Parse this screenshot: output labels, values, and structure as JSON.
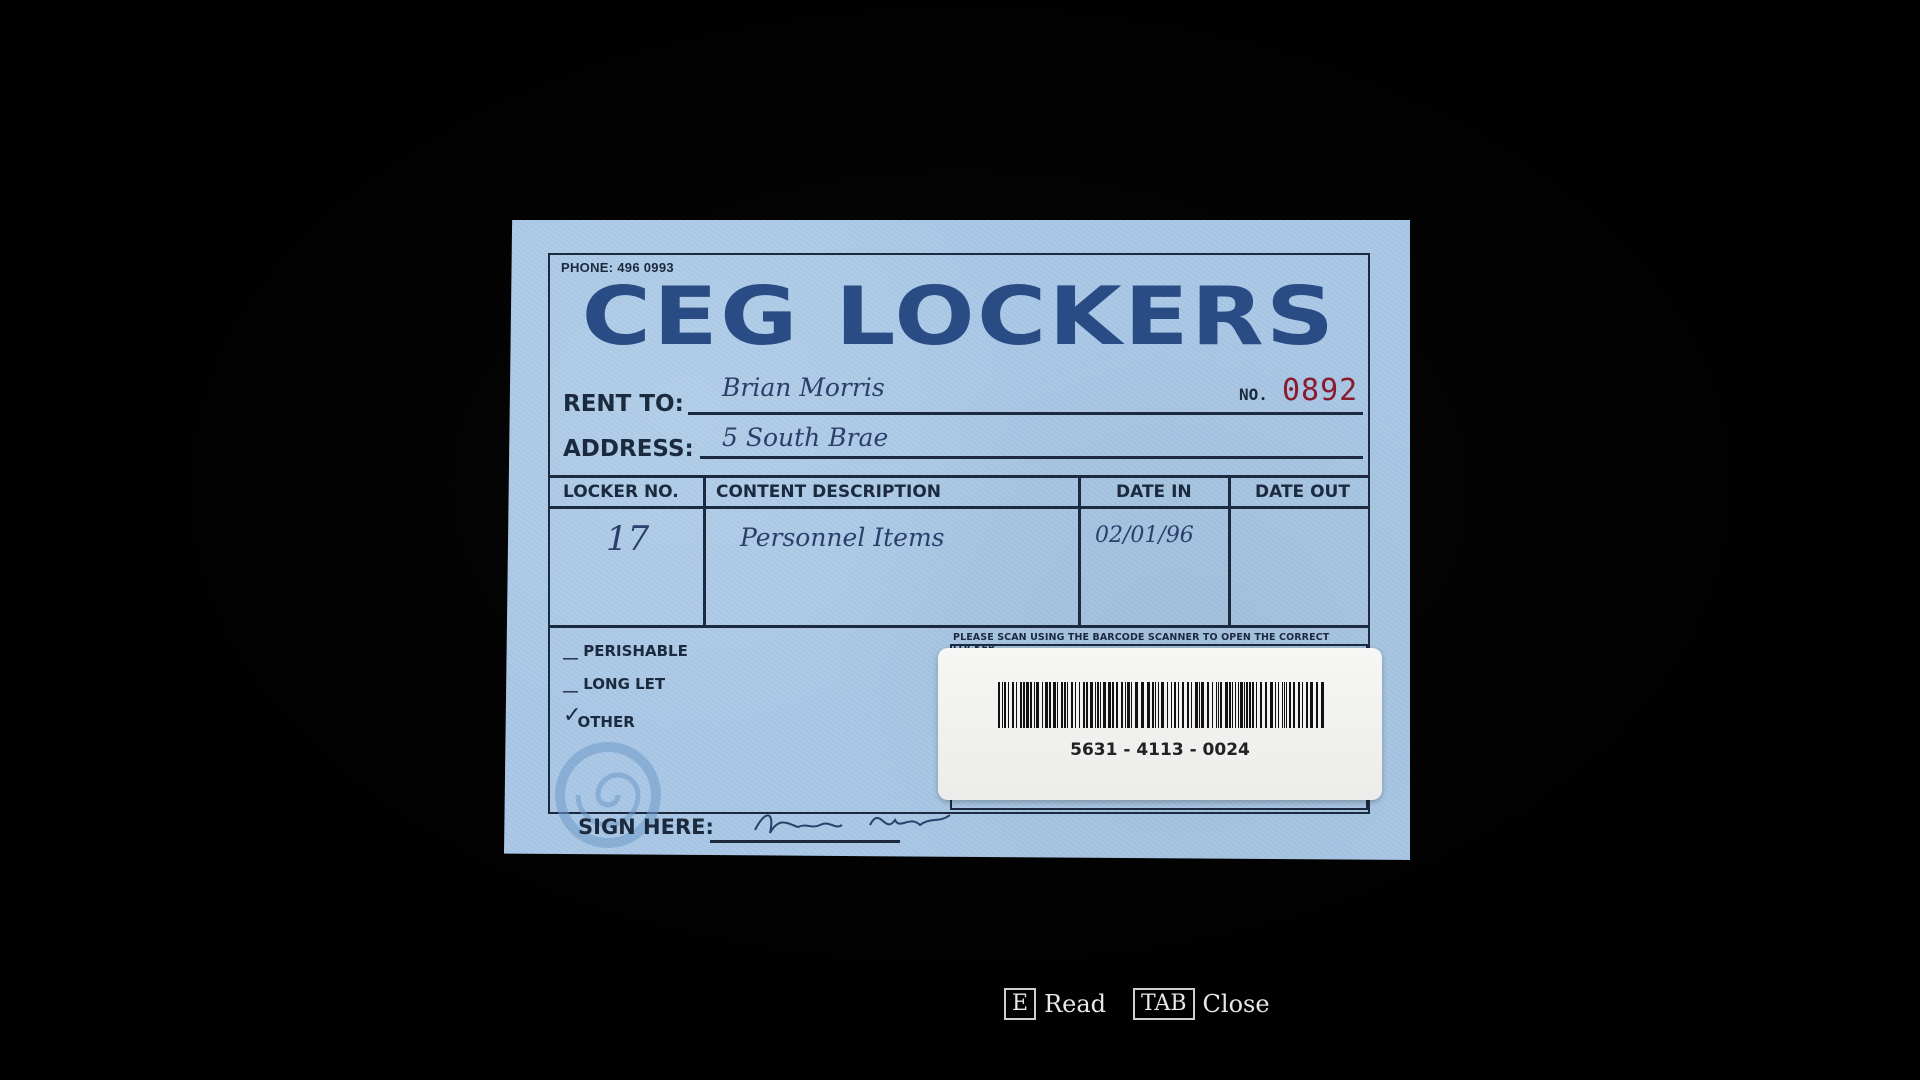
{
  "card": {
    "phone": "PHONE: 496 0993",
    "brand": "CEG LOCKERS",
    "rent_label": "RENT TO:",
    "rent_value": "Brian Morris",
    "no_label": "NO.",
    "no_value": "0892",
    "address_label": "ADDRESS:",
    "address_value": "5 South Brae",
    "table": {
      "headers": [
        "LOCKER NO.",
        "CONTENT DESCRIPTION",
        "DATE IN",
        "DATE OUT"
      ],
      "row": [
        "17",
        "Personnel Items",
        "02/01/96",
        ""
      ]
    },
    "checkboxes": [
      {
        "label": "PERISHABLE",
        "checked": false
      },
      {
        "label": "LONG LET",
        "checked": false
      },
      {
        "label": "OTHER",
        "checked": true
      }
    ],
    "scan_note": "PLEASE SCAN USING THE BARCODE SCANNER TO OPEN THE CORRECT LOCKER",
    "barcode_number": "5631 - 4113 - 0024",
    "sign_label": "SIGN HERE:",
    "watermark": "CEG"
  },
  "hud": {
    "read_key": "E",
    "read_label": "Read",
    "close_key": "TAB",
    "close_label": "Close"
  },
  "colors": {
    "card": "#a9c8e6",
    "ink": "#1b2a3f",
    "brand": "#2a4c84",
    "number": "#8a1b2c"
  }
}
